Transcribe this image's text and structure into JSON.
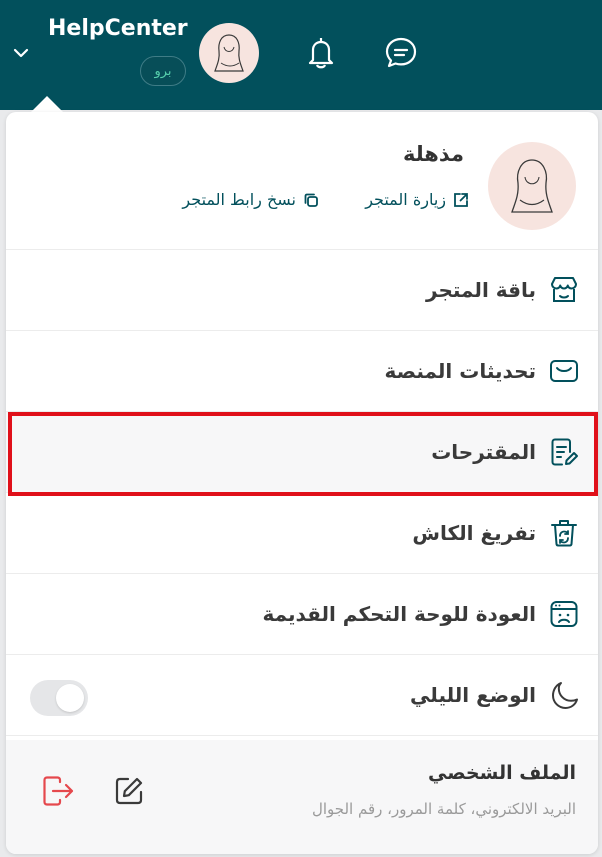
{
  "header": {
    "app_title": "HelpCenter",
    "plan_badge": "برو",
    "icons": [
      "chevron-down-icon",
      "avatar",
      "bell-icon",
      "chat-icon"
    ],
    "background_color": "#02505c"
  },
  "store": {
    "name": "مذهلة",
    "visit_store": "زيارة المتجر",
    "copy_link": "نسخ رابط المتجر"
  },
  "menu": {
    "items": [
      {
        "label": "باقة المتجر",
        "icon": "store-icon"
      },
      {
        "label": "تحديثات المنصة",
        "icon": "updates-icon"
      },
      {
        "label": "المقترحات",
        "icon": "suggestions-icon"
      },
      {
        "label": "تفريغ الكاش",
        "icon": "clear-cache-icon"
      },
      {
        "label": "العودة للوحة التحكم القديمة",
        "icon": "old-dashboard-icon"
      },
      {
        "label": "الوضع الليلي",
        "icon": "moon-icon"
      }
    ],
    "highlighted_item": "المقترحات",
    "highlight_color": "#e0101a"
  },
  "dark_mode": {
    "enabled": false
  },
  "profile": {
    "title": "الملف الشخصي",
    "subtitle": "البريد الالكتروني، كلمة المرور، رقم الجوال",
    "logout_color": "#e5484d"
  }
}
